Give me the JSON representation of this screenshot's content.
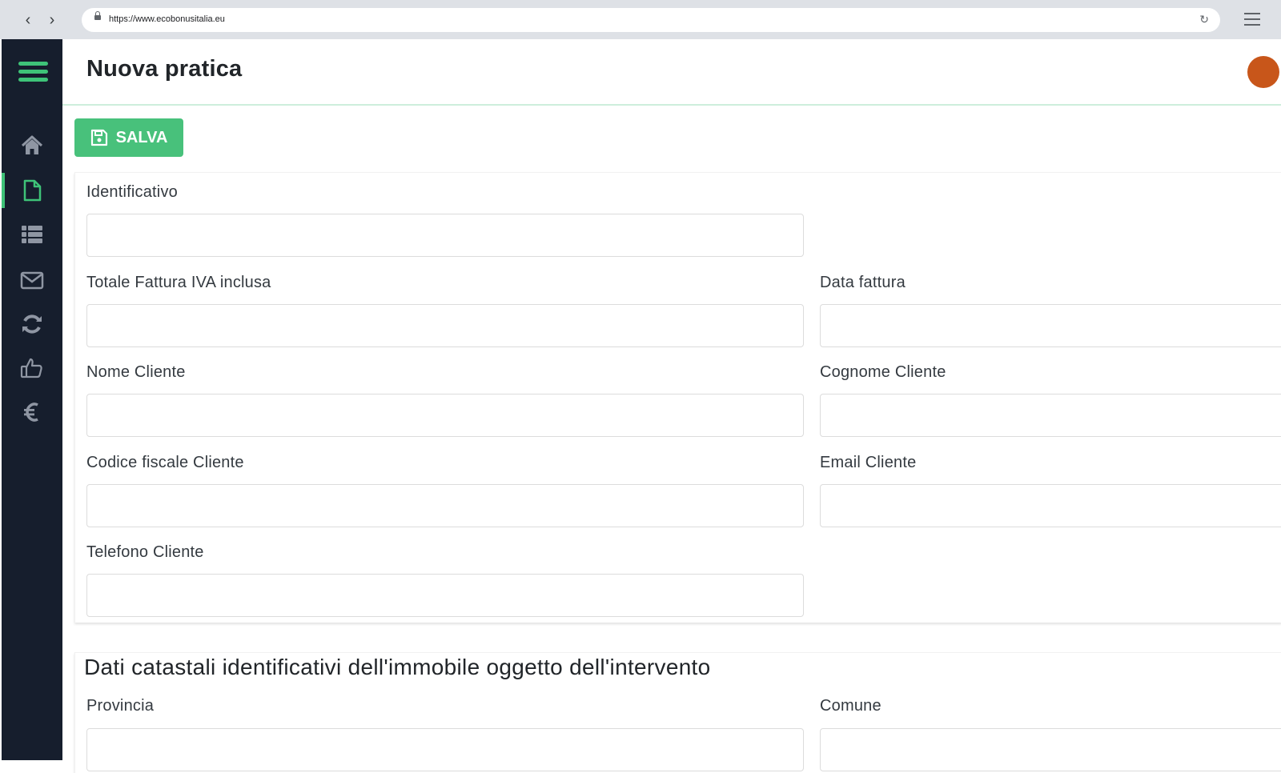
{
  "browser": {
    "url": "https://www.ecobonusitalia.eu",
    "back_icon": "‹",
    "forward_icon": "›",
    "reload_icon": "↻"
  },
  "sidebar": {
    "accent": "#3ec378",
    "background": "#161e2d",
    "items": [
      {
        "icon": "home-icon",
        "active": false
      },
      {
        "icon": "document-icon",
        "active": true
      },
      {
        "icon": "list-icon",
        "active": false
      },
      {
        "icon": "envelope-icon",
        "active": false
      },
      {
        "icon": "refresh-icon",
        "active": false
      },
      {
        "icon": "thumbs-up-icon",
        "active": false
      },
      {
        "icon": "euro-icon",
        "active": false
      }
    ]
  },
  "header": {
    "title": "Nuova pratica"
  },
  "toolbar": {
    "save_label": "SALVA",
    "save_color": "#48c17b"
  },
  "form": {
    "identificativo": {
      "label": "Identificativo",
      "value": ""
    },
    "totale_fattura": {
      "label": "Totale Fattura IVA inclusa",
      "value": ""
    },
    "data_fattura": {
      "label": "Data fattura",
      "value": ""
    },
    "nome_cliente": {
      "label": "Nome Cliente",
      "value": ""
    },
    "cognome_cliente": {
      "label": "Cognome Cliente",
      "value": ""
    },
    "codice_fiscale": {
      "label": "Codice fiscale Cliente",
      "value": ""
    },
    "email_cliente": {
      "label": "Email Cliente",
      "value": ""
    },
    "telefono_cliente": {
      "label": "Telefono Cliente",
      "value": ""
    }
  },
  "catastali": {
    "title": "Dati catastali identificativi dell'immobile oggetto dell'intervento",
    "provincia": {
      "label": "Provincia",
      "value": ""
    },
    "comune": {
      "label": "Comune",
      "value": ""
    }
  }
}
